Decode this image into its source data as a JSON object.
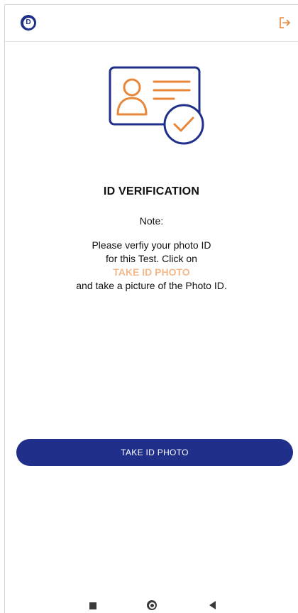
{
  "header": {
    "logo_letter": "D",
    "logout_icon": "logout-icon"
  },
  "hero": {
    "icon": "id-card-verified-icon"
  },
  "content": {
    "title": "ID VERIFICATION",
    "note": "Note:",
    "line1": "Please verfiy your photo ID",
    "line2": "for this Test. Click on",
    "highlight": "TAKE ID PHOTO",
    "line3": "and take a picture of the Photo ID."
  },
  "action": {
    "button_label": "TAKE ID PHOTO"
  },
  "colors": {
    "primary": "#1f2f8a",
    "accent": "#e8873a",
    "highlight": "#f4b98a"
  },
  "nav": {
    "recents_icon": "square-icon",
    "home_icon": "circle-icon",
    "back_icon": "triangle-back-icon"
  }
}
